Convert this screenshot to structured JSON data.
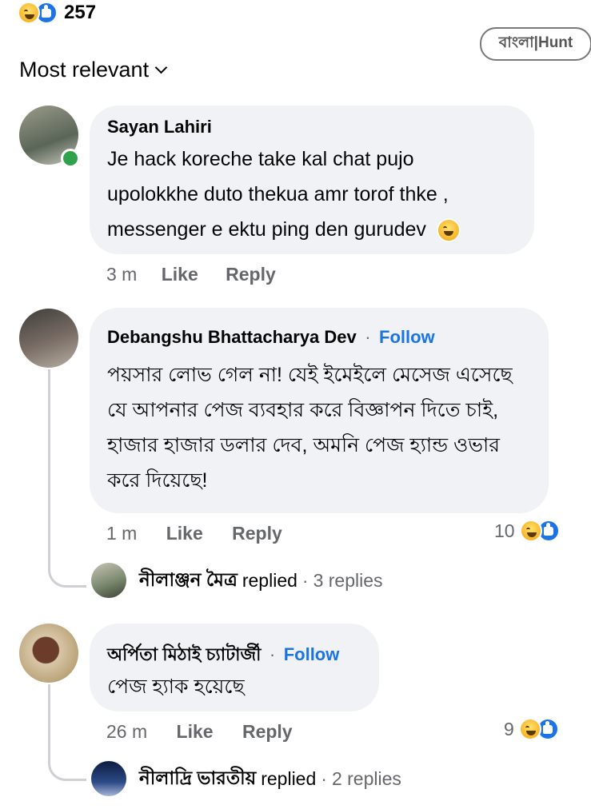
{
  "top": {
    "reaction_count": "257",
    "watermark": "বাংলা|Hunt"
  },
  "sort": {
    "label": "Most relevant"
  },
  "comments": [
    {
      "author": "Sayan Lahiri",
      "lines": [
        "Je hack koreche take kal chat pujo",
        "upolokkhe duto thekua amr torof thke ,",
        "messenger e ektu ping den gurudev"
      ],
      "time": "3 m",
      "like": "Like",
      "reply": "Reply"
    },
    {
      "author": "Debangshu Bhattacharya Dev",
      "follow": "Follow",
      "lines": [
        "পয়সার লোভ গেল না! যেই ইমেইলে মেসেজ এসেছে",
        "যে আপনার পেজ ব্যবহার করে বিজ্ঞাপন দিতে চাই,",
        "হাজার হাজার ডলার দেব, অমনি পেজ হ্যান্ড ওভার",
        "করে দিয়েছে!"
      ],
      "time": "1 m",
      "like": "Like",
      "reply": "Reply",
      "reaction_count": "10",
      "replied_by": "নীলাঞ্জন মৈত্র",
      "replied_word": "replied",
      "replies": "3 replies"
    },
    {
      "author": "অর্পিতা মিঠাই চ্যাটার্জী",
      "follow": "Follow",
      "lines": [
        "পেজ হ্যাক হয়েছে"
      ],
      "time": "26 m",
      "like": "Like",
      "reply": "Reply",
      "reaction_count": "9",
      "replied_by": "নীলাদ্রি ভারতীয়",
      "replied_word": "replied",
      "replies": "2 replies"
    }
  ],
  "separator": "·"
}
